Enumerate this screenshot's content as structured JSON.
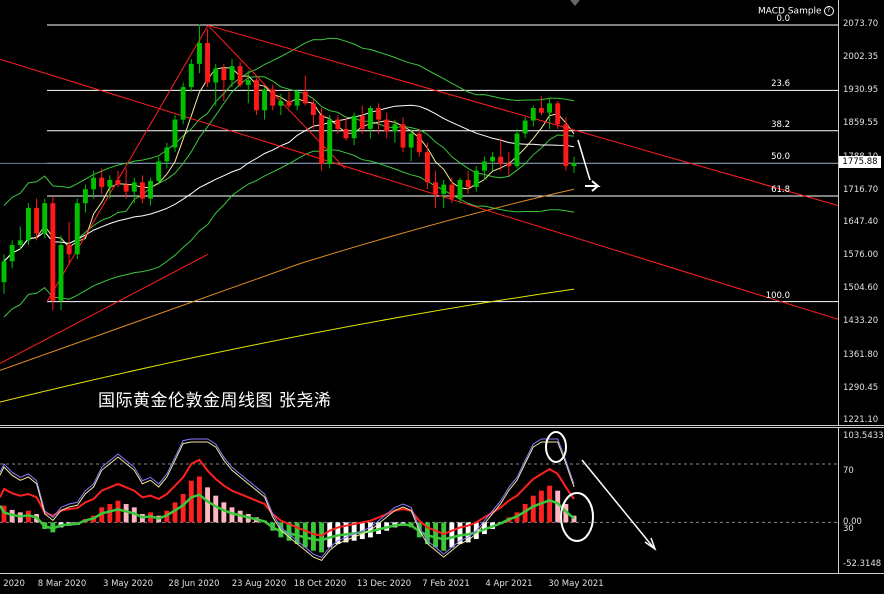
{
  "window": {
    "indicator_title": "MACD Sample",
    "caption": "国际黄金伦敦金周线图 张尧浠",
    "current_price": "1775.88"
  },
  "price_axis": {
    "labels": [
      "2073.70",
      "2002.35",
      "1930.95",
      "1859.55",
      "1788.10",
      "1716.70",
      "1647.40",
      "1576.00",
      "1504.60",
      "1433.20",
      "1361.80",
      "1290.45",
      "1221.10"
    ]
  },
  "fib_levels": [
    {
      "label": "0.0",
      "value": 2073.7
    },
    {
      "label": "23.6",
      "value": 1933.0
    },
    {
      "label": "38.2",
      "value": 1846.0
    },
    {
      "label": "50.0",
      "value": 1775.7
    },
    {
      "label": "61.8",
      "value": 1705.4
    },
    {
      "label": "100.0",
      "value": 1478.0
    }
  ],
  "osc_axis": {
    "labels": [
      "103.5433",
      "70",
      "0.00",
      "30",
      "-52.3148"
    ]
  },
  "time_axis": {
    "labels": [
      "n 2020",
      "8 Mar 2020",
      "3 May 2020",
      "28 Jun 2020",
      "23 Aug 2020",
      "18 Oct 2020",
      "13 Dec 2020",
      "7 Feb 2021",
      "4 Apr 2021",
      "30 May 2021"
    ]
  },
  "colors": {
    "background": "#000000",
    "bull_candle": "#00c000",
    "bear_candle": "#ff1a1a",
    "channel": "#ff2020",
    "ma_green": "#3cc63c",
    "ma_orange": "#e08c28",
    "ma_yellow": "#e6e600",
    "ma_white": "#ffffff",
    "fib": "#ffffff"
  },
  "chart_data": {
    "type": "candlestick",
    "ylim": [
      1221.1,
      2073.7
    ],
    "candles": [
      [
        1520,
        1580,
        1495,
        1565
      ],
      [
        1565,
        1610,
        1550,
        1600
      ],
      [
        1600,
        1640,
        1590,
        1610
      ],
      [
        1610,
        1690,
        1600,
        1680
      ],
      [
        1680,
        1700,
        1610,
        1625
      ],
      [
        1625,
        1700,
        1615,
        1690
      ],
      [
        1690,
        1705,
        1460,
        1480
      ],
      [
        1480,
        1620,
        1460,
        1600
      ],
      [
        1600,
        1650,
        1560,
        1580
      ],
      [
        1580,
        1700,
        1570,
        1690
      ],
      [
        1690,
        1730,
        1670,
        1720
      ],
      [
        1720,
        1760,
        1700,
        1745
      ],
      [
        1745,
        1765,
        1710,
        1725
      ],
      [
        1725,
        1750,
        1700,
        1740
      ],
      [
        1740,
        1760,
        1725,
        1730
      ],
      [
        1730,
        1765,
        1700,
        1715
      ],
      [
        1715,
        1745,
        1690,
        1735
      ],
      [
        1735,
        1750,
        1690,
        1700
      ],
      [
        1700,
        1745,
        1685,
        1738
      ],
      [
        1738,
        1790,
        1730,
        1780
      ],
      [
        1780,
        1820,
        1765,
        1810
      ],
      [
        1810,
        1880,
        1800,
        1870
      ],
      [
        1870,
        1950,
        1860,
        1940
      ],
      [
        1940,
        2000,
        1930,
        1990
      ],
      [
        1990,
        2075,
        1970,
        2035
      ],
      [
        2035,
        2065,
        1940,
        1950
      ],
      [
        1950,
        1990,
        1900,
        1980
      ],
      [
        1980,
        1990,
        1910,
        1955
      ],
      [
        1955,
        2000,
        1940,
        1985
      ],
      [
        1985,
        1995,
        1940,
        1945
      ],
      [
        1945,
        1975,
        1905,
        1955
      ],
      [
        1955,
        1960,
        1880,
        1890
      ],
      [
        1890,
        1940,
        1870,
        1935
      ],
      [
        1935,
        1945,
        1890,
        1900
      ],
      [
        1900,
        1925,
        1880,
        1910
      ],
      [
        1910,
        1930,
        1895,
        1900
      ],
      [
        1900,
        1935,
        1890,
        1930
      ],
      [
        1930,
        1965,
        1900,
        1905
      ],
      [
        1905,
        1915,
        1850,
        1880
      ],
      [
        1880,
        1895,
        1760,
        1775
      ],
      [
        1775,
        1880,
        1765,
        1870
      ],
      [
        1870,
        1880,
        1840,
        1850
      ],
      [
        1850,
        1875,
        1825,
        1830
      ],
      [
        1830,
        1885,
        1815,
        1878
      ],
      [
        1878,
        1900,
        1840,
        1850
      ],
      [
        1850,
        1900,
        1830,
        1895
      ],
      [
        1895,
        1905,
        1840,
        1870
      ],
      [
        1870,
        1885,
        1830,
        1845
      ],
      [
        1845,
        1870,
        1820,
        1860
      ],
      [
        1860,
        1875,
        1800,
        1810
      ],
      [
        1810,
        1850,
        1780,
        1840
      ],
      [
        1840,
        1850,
        1790,
        1800
      ],
      [
        1800,
        1820,
        1720,
        1735
      ],
      [
        1735,
        1760,
        1680,
        1710
      ],
      [
        1710,
        1740,
        1680,
        1730
      ],
      [
        1730,
        1745,
        1690,
        1700
      ],
      [
        1700,
        1745,
        1690,
        1740
      ],
      [
        1740,
        1760,
        1710,
        1725
      ],
      [
        1725,
        1770,
        1715,
        1760
      ],
      [
        1760,
        1790,
        1740,
        1780
      ],
      [
        1780,
        1800,
        1760,
        1790
      ],
      [
        1790,
        1830,
        1760,
        1775
      ],
      [
        1775,
        1800,
        1750,
        1770
      ],
      [
        1770,
        1850,
        1765,
        1840
      ],
      [
        1840,
        1875,
        1830,
        1868
      ],
      [
        1868,
        1900,
        1855,
        1895
      ],
      [
        1895,
        1920,
        1880,
        1885
      ],
      [
        1885,
        1915,
        1850,
        1905
      ],
      [
        1905,
        1910,
        1850,
        1860
      ],
      [
        1860,
        1875,
        1760,
        1770
      ],
      [
        1770,
        1790,
        1755,
        1776
      ]
    ],
    "macd_hist": [
      20,
      15,
      12,
      14,
      10,
      -8,
      -12,
      -6,
      -4,
      -3,
      4,
      8,
      18,
      22,
      26,
      22,
      18,
      10,
      12,
      8,
      14,
      24,
      34,
      50,
      55,
      42,
      32,
      24,
      18,
      14,
      10,
      6,
      2,
      -10,
      -18,
      -22,
      -26,
      -30,
      -34,
      -36,
      -30,
      -26,
      -24,
      -22,
      -20,
      -18,
      -14,
      -10,
      -6,
      -4,
      -6,
      -18,
      -26,
      -30,
      -34,
      -30,
      -26,
      -24,
      -20,
      -14,
      -8,
      -2,
      6,
      12,
      22,
      32,
      38,
      44,
      38,
      22,
      8
    ]
  }
}
